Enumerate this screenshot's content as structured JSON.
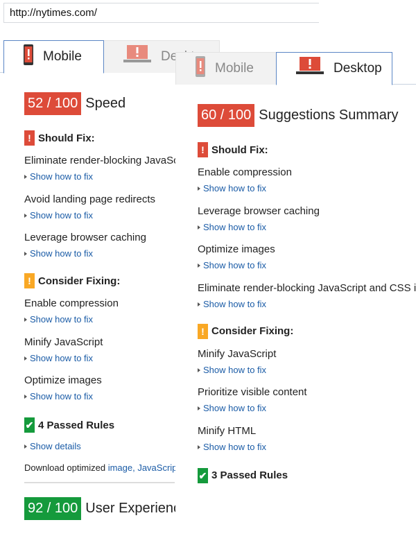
{
  "url": "http://nytimes.com/",
  "colors": {
    "red": "#dd4b39",
    "orange": "#f9a825",
    "green": "#159a3c",
    "link": "#1a5ba6"
  },
  "left": {
    "tabs": [
      {
        "label": "Mobile",
        "icon": "phone-icon",
        "active": true
      },
      {
        "label": "Desktop",
        "icon": "laptop-icon",
        "active": false
      }
    ],
    "score": {
      "value": "52 / 100",
      "label": "Speed"
    },
    "should_fix": {
      "title": "Should Fix:",
      "items": [
        {
          "title": "Eliminate render-blocking JavaScript and CSS in above-the-fold content",
          "link": "Show how to fix"
        },
        {
          "title": "Avoid landing page redirects",
          "link": "Show how to fix"
        },
        {
          "title": "Leverage browser caching",
          "link": "Show how to fix"
        }
      ]
    },
    "consider": {
      "title": "Consider Fixing:",
      "items": [
        {
          "title": "Enable compression",
          "link": "Show how to fix"
        },
        {
          "title": "Minify JavaScript",
          "link": "Show how to fix"
        },
        {
          "title": "Optimize images",
          "link": "Show how to fix"
        }
      ]
    },
    "passed": {
      "title": "4 Passed Rules",
      "link": "Show details"
    },
    "download": {
      "text": "Download optimized ",
      "links": "image, JavaScript"
    },
    "ux_score": {
      "value": "92 / 100",
      "label": "User Experience"
    }
  },
  "right": {
    "tabs": [
      {
        "label": "Mobile",
        "icon": "phone-icon",
        "active": false
      },
      {
        "label": "Desktop",
        "icon": "laptop-icon",
        "active": true
      }
    ],
    "score": {
      "value": "60 / 100",
      "label": "Suggestions Summary"
    },
    "should_fix": {
      "title": "Should Fix:",
      "items": [
        {
          "title": "Enable compression",
          "link": "Show how to fix"
        },
        {
          "title": "Leverage browser caching",
          "link": "Show how to fix"
        },
        {
          "title": "Optimize images",
          "link": "Show how to fix"
        },
        {
          "title": "Eliminate render-blocking JavaScript and CSS in above-the-fold content",
          "link": "Show how to fix"
        }
      ]
    },
    "consider": {
      "title": "Consider Fixing:",
      "items": [
        {
          "title": "Minify JavaScript",
          "link": "Show how to fix"
        },
        {
          "title": "Prioritize visible content",
          "link": "Show how to fix"
        },
        {
          "title": "Minify HTML",
          "link": "Show how to fix"
        }
      ]
    },
    "passed": {
      "title": "3 Passed Rules"
    }
  }
}
